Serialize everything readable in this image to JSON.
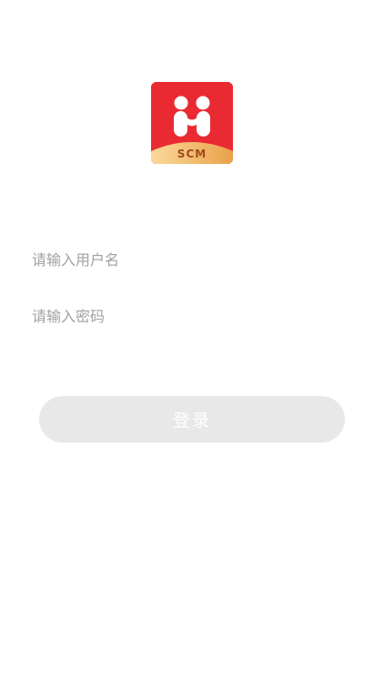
{
  "logo": {
    "text": "SCM",
    "colors": {
      "background": "#ea2a33",
      "mark": "#ffffff",
      "banner_start": "#fbd99a",
      "banner_end": "#e8a24a",
      "banner_text": "#a24a1c"
    }
  },
  "login_form": {
    "username_placeholder": "请输入用户名",
    "username_value": "",
    "password_placeholder": "请输入密码",
    "password_value": "",
    "login_label": "登录",
    "login_button_color": "#e8e8e8"
  }
}
